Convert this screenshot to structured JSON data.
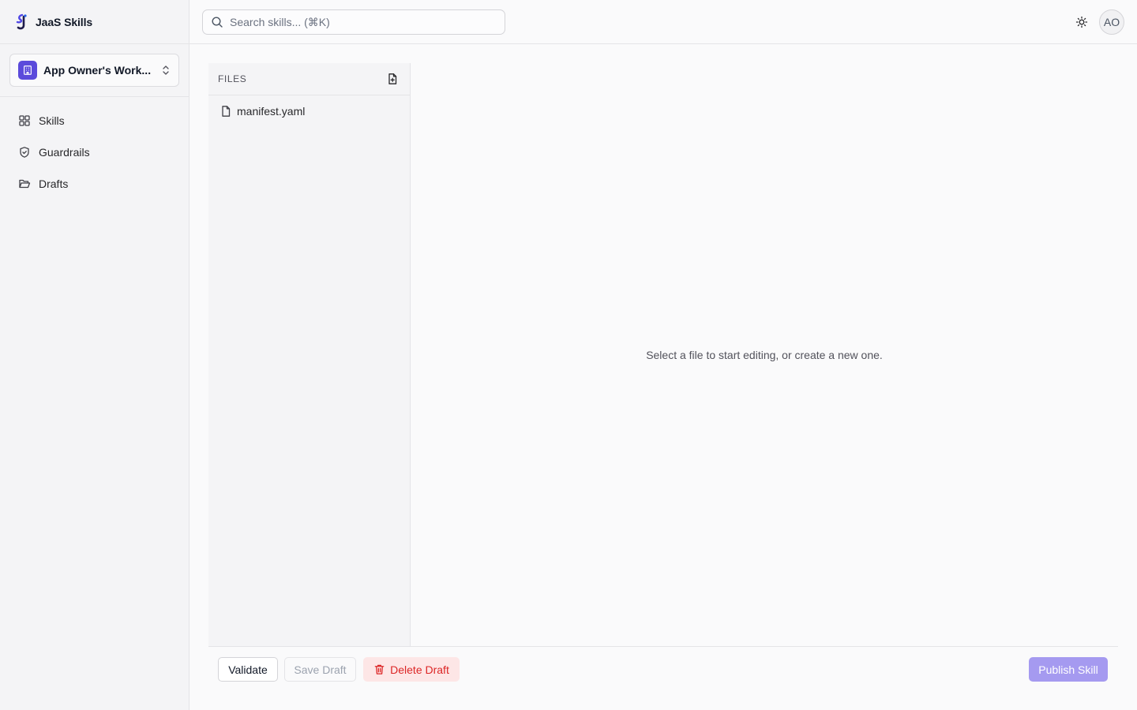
{
  "brand": {
    "name": "JaaS Skills",
    "logo_icon": "jaas-logo-icon"
  },
  "workspace": {
    "name": "App Owner's Work...",
    "icon": "building-icon",
    "badge_color": "#5b4bdb"
  },
  "nav": {
    "items": [
      {
        "label": "Skills",
        "icon": "grid-icon"
      },
      {
        "label": "Guardrails",
        "icon": "shield-icon"
      },
      {
        "label": "Drafts",
        "icon": "folder-open-icon"
      }
    ]
  },
  "search": {
    "placeholder": "Search skills... (⌘K)",
    "value": ""
  },
  "header": {
    "theme_icon": "sun-icon",
    "avatar_initials": "AO"
  },
  "files": {
    "title": "FILES",
    "new_file_icon": "file-plus-icon",
    "items": [
      {
        "name": "manifest.yaml",
        "icon": "file-icon"
      }
    ]
  },
  "editor": {
    "empty_message": "Select a file to start editing, or create a new one."
  },
  "footer": {
    "validate_label": "Validate",
    "save_draft_label": "Save Draft",
    "delete_draft_label": "Delete Draft",
    "delete_icon": "trash-icon",
    "publish_label": "Publish Skill"
  },
  "colors": {
    "accent": "#5b4bdb",
    "publish_disabled": "#a59af0",
    "danger": "#dc2626",
    "danger_bg": "#fde6e6"
  }
}
